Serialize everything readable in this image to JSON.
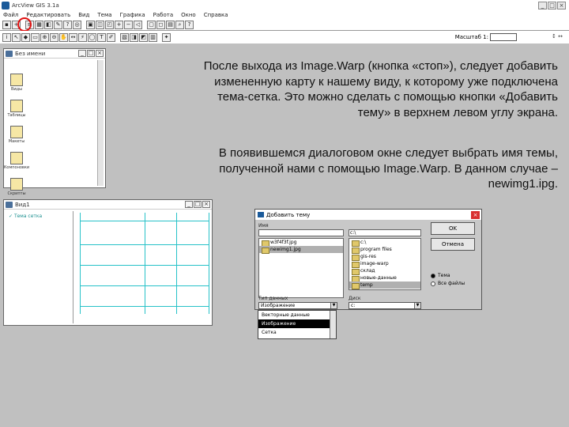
{
  "app": {
    "title": "ArcView GIS 3.1a"
  },
  "menu": [
    "Файл",
    "Редактировать",
    "Вид",
    "Тема",
    "Графика",
    "Работа",
    "Окно",
    "Справка"
  ],
  "toolbar": {
    "scale_label": "Масштаб 1:",
    "scale_value": ""
  },
  "project_window": {
    "title": "Без имени",
    "icons": [
      {
        "label": "Виды",
        "icon": "views-icon"
      },
      {
        "label": "Таблицы",
        "icon": "tables-icon"
      },
      {
        "label": "Макеты",
        "icon": "charts-icon"
      },
      {
        "label": "Компоновки",
        "icon": "layouts-icon"
      },
      {
        "label": "Скрипты",
        "icon": "scripts-icon"
      }
    ]
  },
  "view_window": {
    "title": "Вид1",
    "legend_item": "Тема сетка"
  },
  "instructions": {
    "p1_l1": "После выхода из Image.Warp (кнопка «стоп»), следует добавить",
    "p1_l2": "измененную карту к нашему виду, к которому уже подключена",
    "p1_l3": "тема-сетка. Это можно сделать с помощью кнопки «Добавить",
    "p1_l4": "тему» в верхнем левом углу экрана.",
    "p2_l1": "В появившемся диалоговом окне следует выбрать имя темы,",
    "p2_l2": "полученной нами с помощью Image.Warp. В данном случае –",
    "p2_l3": "newimg1.ipg."
  },
  "dialog": {
    "title": "Добавить тему",
    "file_label": "Имя",
    "file_value": "",
    "path_value": "c:\\",
    "files": [
      "w3f4f3f.jpg",
      "newimg1.jpg"
    ],
    "folders": [
      "c:\\",
      "program files",
      "gis-res",
      "image-warp",
      "склад",
      "новые-данные",
      "temp"
    ],
    "ok_label": "OK",
    "cancel_label": "Отмена",
    "radio_1": "Тема",
    "radio_2": "Все файлы",
    "type_label": "Тип данных",
    "type_value": "Изображение",
    "drive_label": "Диск",
    "drive_value": "c:"
  },
  "dropdown": {
    "options": [
      "Векторные данные",
      "Изображение",
      "Сетка"
    ]
  },
  "colors": {
    "grid_line": "#27c2c8",
    "highlight_ring": "#e01010"
  }
}
